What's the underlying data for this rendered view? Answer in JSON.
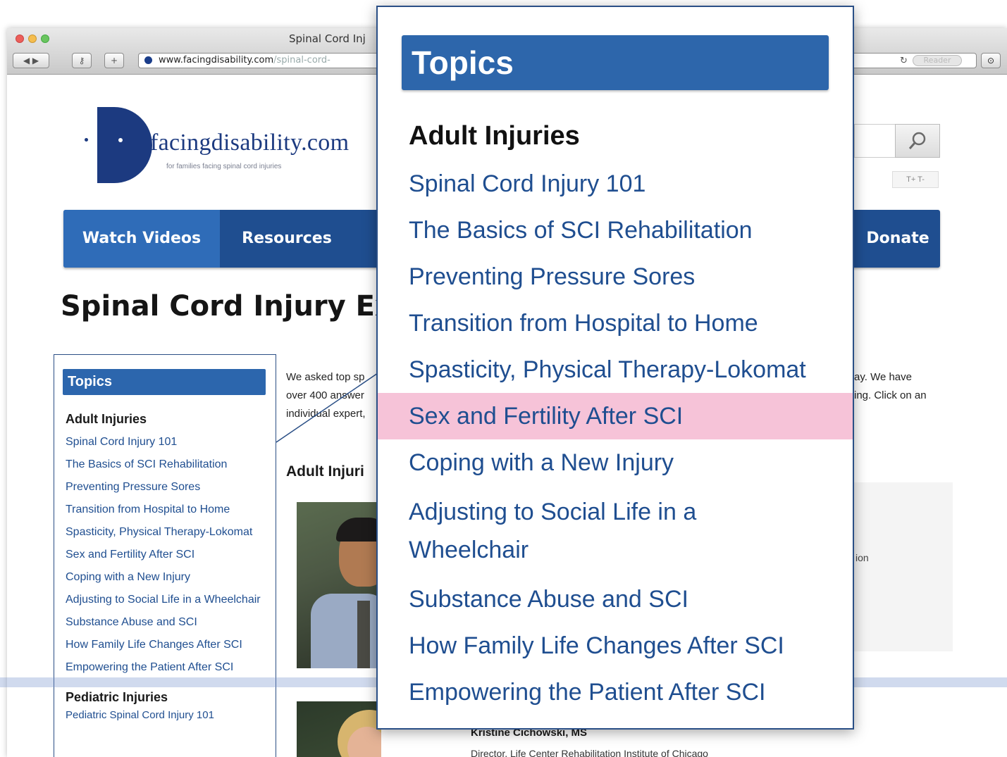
{
  "browser": {
    "window_title": "Spinal Cord Inj",
    "url_host": "www.facingdisability.com",
    "url_path": "/spinal-cord-",
    "reader_label": "Reader",
    "back_label": "◀ ▶"
  },
  "site": {
    "logo_text": "facingdisability.com",
    "logo_tagline": "for families facing spinal cord injuries",
    "text_size_label": "T+ T-"
  },
  "nav": {
    "items": [
      "Watch Videos",
      "Resources",
      "Donate"
    ]
  },
  "page": {
    "title": "Spinal Cord Injury Expe",
    "intro_left": [
      "We asked top sp",
      "over 400 answer",
      "individual expert,"
    ],
    "intro_right": [
      "ay. We have",
      "ing. Click on an"
    ],
    "section_heading": "Adult Injuri",
    "right_fragment": "ion"
  },
  "sidebar": {
    "header": "Topics",
    "section_adult": "Adult Injuries",
    "items": [
      "Spinal Cord Injury 101",
      "The Basics of SCI Rehabilitation",
      "Preventing Pressure Sores",
      "Transition from Hospital to Home",
      "Spasticity, Physical Therapy-Lokomat",
      "Sex and Fertility After SCI",
      "Coping with a New Injury",
      "Adjusting to Social Life in a Wheelchair",
      "Substance Abuse and SCI",
      "How Family Life Changes After SCI",
      "Empowering the Patient After SCI"
    ],
    "section_pediatric": "Pediatric Injuries",
    "pediatric_cut": "Pediatric Spinal Cord Injury 101"
  },
  "expert": {
    "name": "Kristine Cichowski, MS",
    "role": "Director, Life Center Rehabilitation Institute of Chicago"
  },
  "callout": {
    "header": "Topics",
    "section": "Adult Injuries",
    "items": [
      "Spinal Cord Injury 101",
      "The Basics of SCI Rehabilitation",
      "Preventing Pressure Sores",
      "Transition from Hospital to Home",
      "Spasticity, Physical Therapy-Lokomat",
      "Sex and Fertility After SCI",
      "Coping with a New Injury",
      "Adjusting to Social Life in a Wheelchair",
      "Substance Abuse and SCI",
      "How Family Life Changes After SCI",
      "Empowering the Patient After SCI"
    ],
    "highlighted_item": "Sex and Fertility After SCI",
    "highlight_color": "#f6c3d8"
  },
  "colors": {
    "nav_blue": "#1f4e90",
    "header_blue": "#2d66ab",
    "link_blue": "#1f4e90"
  }
}
